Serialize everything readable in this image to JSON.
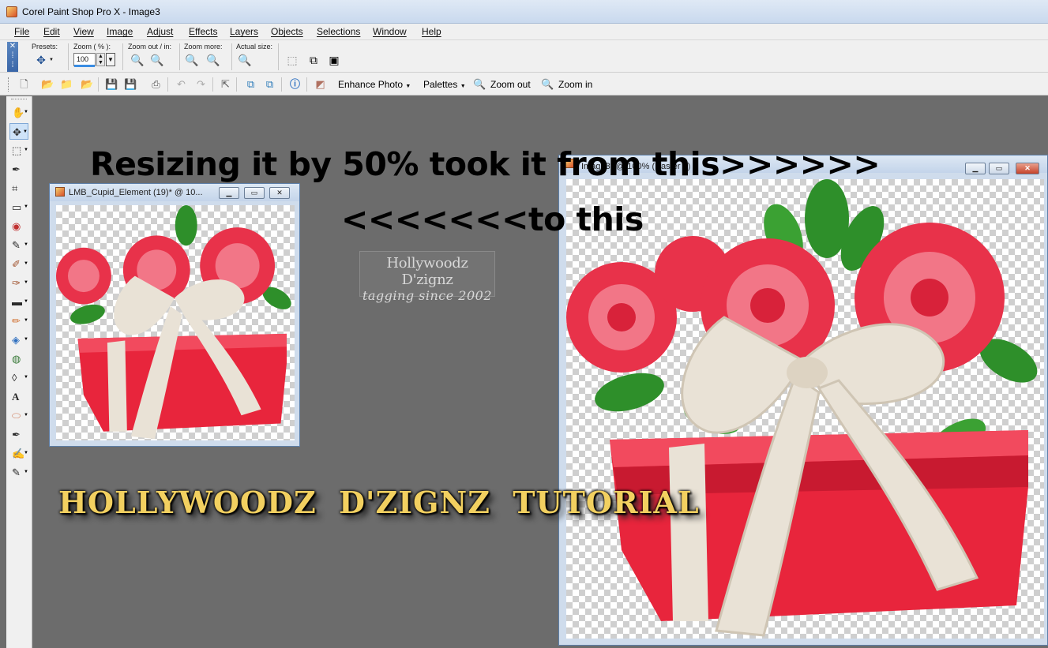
{
  "app": {
    "title": "Corel Paint Shop Pro X - Image3"
  },
  "menu": {
    "items": [
      "File",
      "Edit",
      "View",
      "Image",
      "Adjust",
      "Effects",
      "Layers",
      "Objects",
      "Selections",
      "Window",
      "Help"
    ]
  },
  "tool_options": {
    "presets_label": "Presets:",
    "zoom_label": "Zoom ( % ):",
    "zoom_value": "100",
    "zoom_out_in_label": "Zoom out / in:",
    "zoom_more_label": "Zoom more:",
    "actual_size_label": "Actual size:"
  },
  "standard_toolbar": {
    "enhance_photo": "Enhance Photo",
    "palettes": "Palettes",
    "zoom_out": "Zoom out",
    "zoom_in": "Zoom in"
  },
  "tools": [
    "pan-tool",
    "move-tool",
    "selection-tool",
    "dropper-tool",
    "crop-tool",
    "deform-tool",
    "red-eye-tool",
    "makeover-tool",
    "clone-tool",
    "paint-brush-tool",
    "scratch-remover-tool",
    "eraser-tool",
    "dodge-tool",
    "fill-tool",
    "smudge-tool",
    "text-tool",
    "shape-tool",
    "pen-tool",
    "warp-brush-tool",
    "air-brush-tool"
  ],
  "overlay": {
    "heading_line1": "Resizing it by 50% took it from this>>>>>>",
    "heading_line2": "<<<<<<<to this",
    "watermark_line1": "Hollywoodz D'zignz",
    "watermark_line2": "tagging since 2002",
    "tutorial_banner": "HOLLYWOODZ D'ZIGNZ TUTORIAL"
  },
  "documents": {
    "small": {
      "title": "LMB_Cupid_Element (19)* @ 10..."
    },
    "large": {
      "title": "Image3* @ 100% (Raster 1)"
    }
  },
  "colors": {
    "workspace": "#6c6c6c",
    "gift_box": "#e8253c",
    "rose": "#e8324a",
    "ribbon": "#e9e2d6",
    "leaf": "#2e8f2a",
    "banner_text": "#f2d060"
  }
}
